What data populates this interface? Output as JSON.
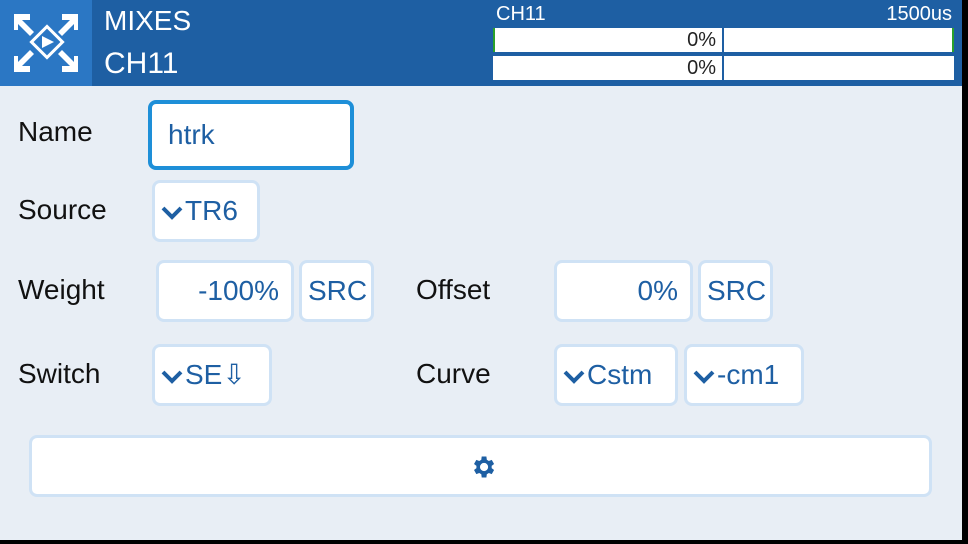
{
  "header": {
    "title": "MIXES",
    "subtitle": "CH11",
    "channel": {
      "label": "CH11",
      "value": "1500us",
      "bars": [
        {
          "percent": "0%"
        },
        {
          "percent": "0%"
        }
      ]
    }
  },
  "form": {
    "name": {
      "label": "Name",
      "value": "htrk"
    },
    "source": {
      "label": "Source",
      "value": "TR6"
    },
    "weight": {
      "label": "Weight",
      "value": "-100%",
      "src_label": "SRC"
    },
    "offset": {
      "label": "Offset",
      "value": "0%",
      "src_label": "SRC"
    },
    "switch": {
      "label": "Switch",
      "value": "SE⇩"
    },
    "curve": {
      "label": "Curve",
      "type": "Cstm",
      "value": "-cm1"
    }
  },
  "colors": {
    "header": "#1e5fa3",
    "body": "#e8eef5",
    "accent": "#1e8fd8",
    "text_accent": "#1e5fa3"
  },
  "icons": {
    "logo": "app-logo-icon",
    "settings": "gear-icon"
  }
}
